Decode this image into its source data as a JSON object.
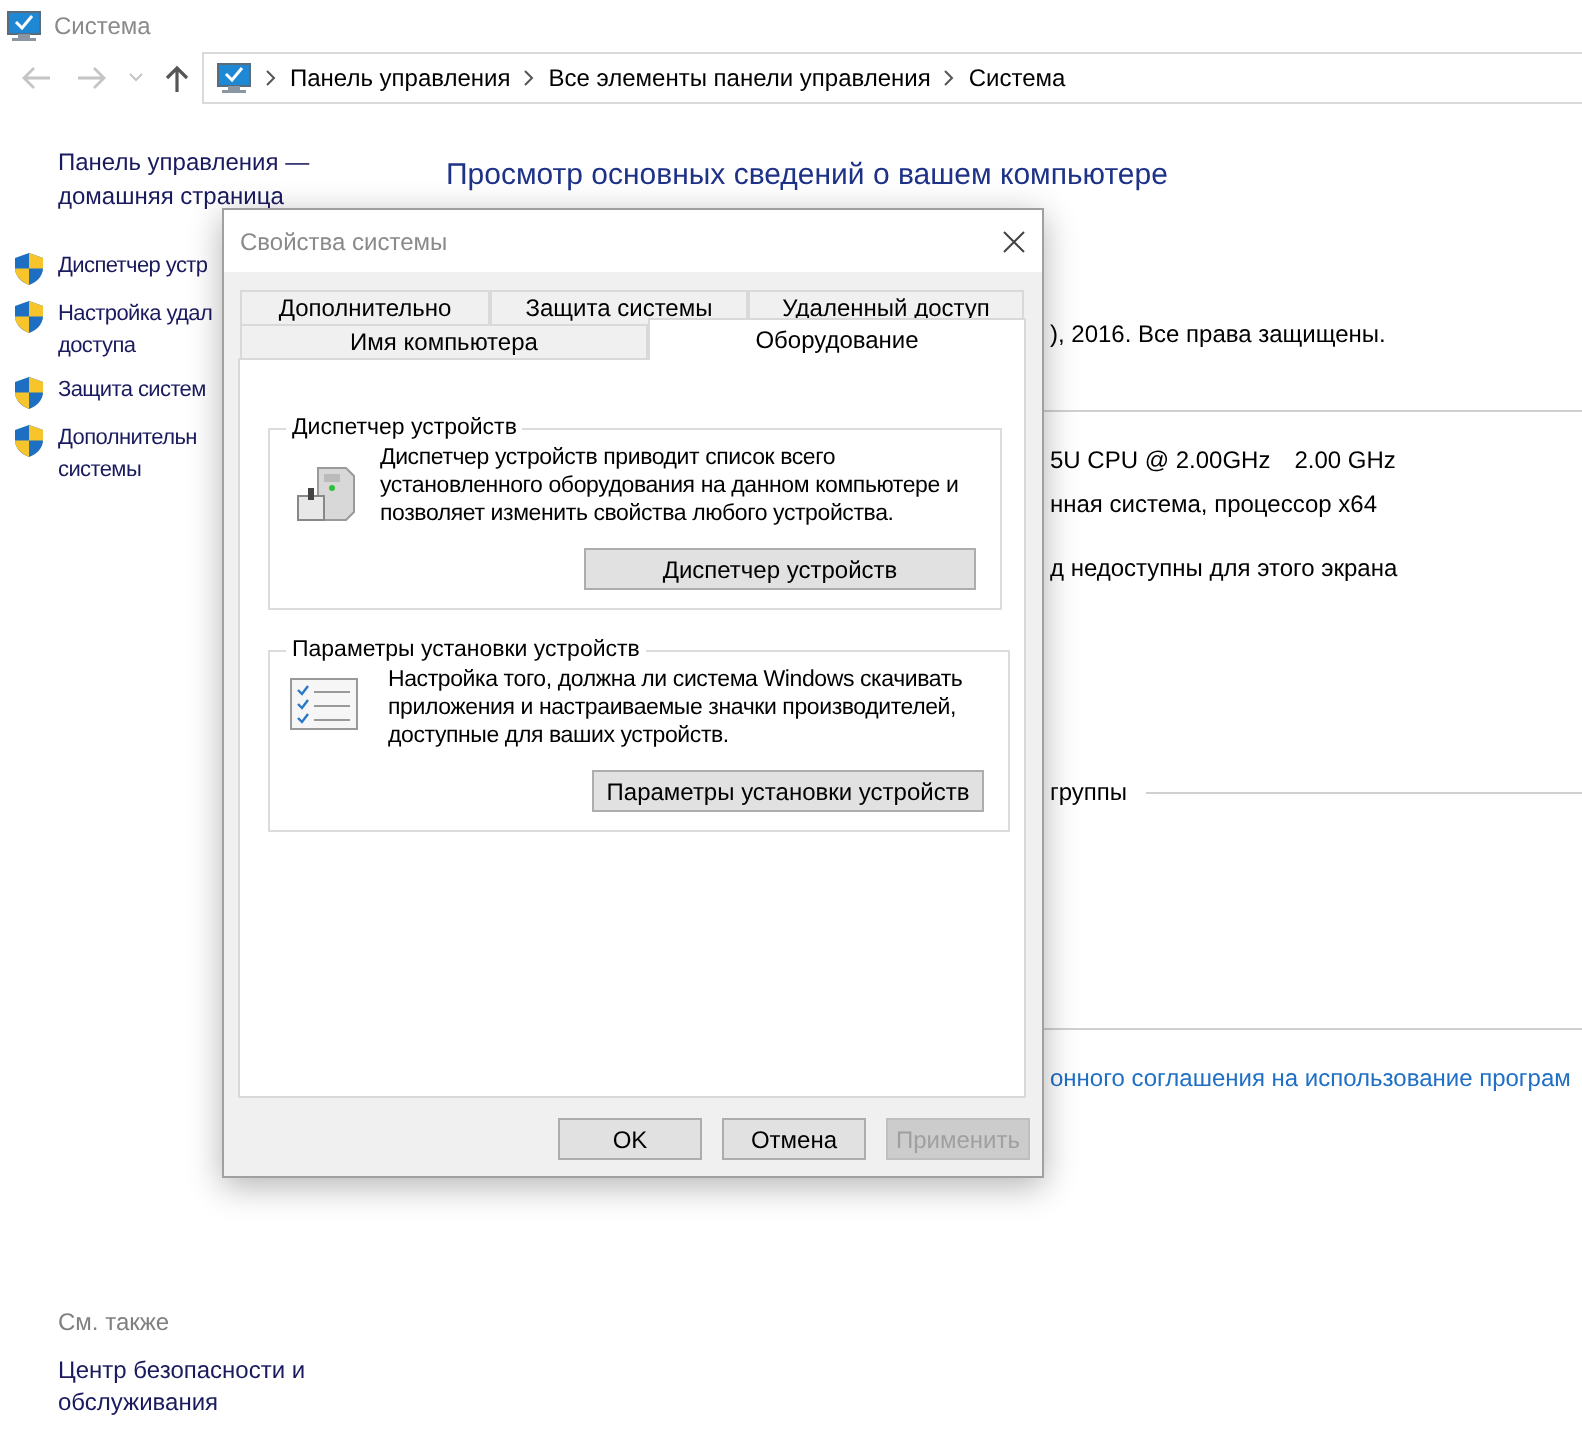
{
  "window": {
    "title": "Система"
  },
  "navigation": {
    "breadcrumbs": [
      "Панель управления",
      "Все элементы панели управления",
      "Система"
    ]
  },
  "sidebar": {
    "home_link": "Панель управления — домашняя страница",
    "items": [
      {
        "lines": [
          "Диспетчер устр"
        ]
      },
      {
        "lines": [
          "Настройка удал",
          "доступа"
        ]
      },
      {
        "lines": [
          "Защита систем"
        ]
      },
      {
        "lines": [
          "Дополнительн",
          "системы"
        ]
      }
    ],
    "see_also": {
      "title": "См. также",
      "links": [
        "Центр безопасности и обслуживания"
      ]
    }
  },
  "main": {
    "heading": "Просмотр основных сведений о вашем компьютере",
    "details": [
      {
        "kind": "text",
        "texts": [
          "), 2016. Все права защищены."
        ]
      },
      {
        "kind": "text",
        "texts": [
          "5U CPU @ 2.00GHz",
          "2.00 GHz"
        ]
      },
      {
        "kind": "text",
        "texts": [
          "нная система, процессор x64"
        ]
      },
      {
        "kind": "text",
        "texts": [
          "д недоступны для этого экрана"
        ]
      },
      {
        "kind": "section",
        "texts": [
          "группы"
        ]
      },
      {
        "kind": "link",
        "texts": [
          "онного соглашения на использование програм"
        ]
      }
    ]
  },
  "dialog": {
    "title": "Свойства системы",
    "tab_rows": [
      [
        {
          "label": "Дополнительно",
          "selected": false
        },
        {
          "label": "Защита системы",
          "selected": false
        },
        {
          "label": "Удаленный доступ",
          "selected": false
        }
      ],
      [
        {
          "label": "Имя компьютера",
          "selected": false
        },
        {
          "label": "Оборудование",
          "selected": true
        }
      ]
    ],
    "groups": [
      {
        "kind": "device-manager",
        "title": "Диспетчер устройств",
        "description": "Диспетчер устройств приводит список всего установленного оборудования на данном компьютере и позволяет изменить свойства любого устройства.",
        "button": "Диспетчер устройств"
      },
      {
        "kind": "installation-settings",
        "title": "Параметры установки устройств",
        "description": "Настройка того, должна ли система Windows скачивать приложения и настраиваемые значки производителей, доступные для ваших устройств.",
        "button": "Параметры установки устройств"
      }
    ],
    "buttons": [
      {
        "label": "OK",
        "disabled": false
      },
      {
        "label": "Отмена",
        "disabled": false
      },
      {
        "label": "Применить",
        "disabled": true
      }
    ]
  }
}
